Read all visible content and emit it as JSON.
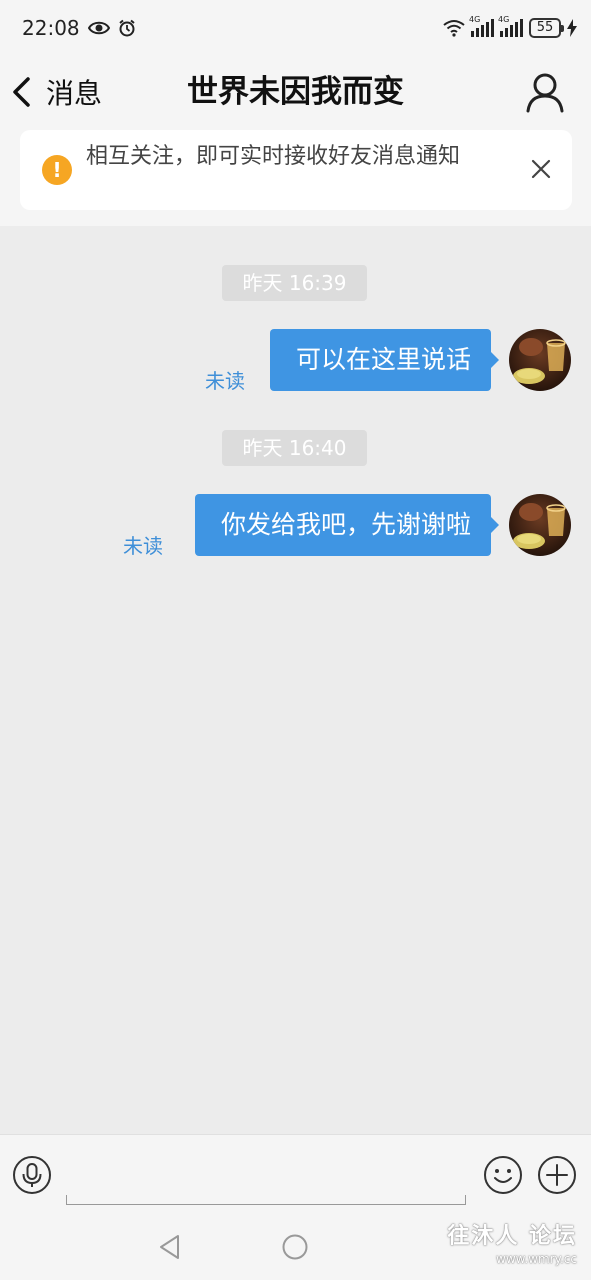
{
  "status_bar": {
    "time": "22:08",
    "signal_label_1": "4G",
    "signal_label_2": "4G",
    "battery": "55"
  },
  "header": {
    "back_label": "消息",
    "title": "世界未因我而变"
  },
  "notice": {
    "text": "相互关注，即可实时接收好友消息通知",
    "icon": "!"
  },
  "messages": [
    {
      "timestamp": "昨天 16:39",
      "text": "可以在这里说话",
      "status": "未读"
    },
    {
      "timestamp": "昨天 16:40",
      "text": "你发给我吧，先谢谢啦",
      "status": "未读"
    }
  ],
  "input": {
    "placeholder": "",
    "value": ""
  },
  "watermark": {
    "main": "往沐人 论坛",
    "sub": "www.wmry.cc"
  },
  "colors": {
    "bubble": "#3f95e3",
    "unread_text": "#3f8fd8",
    "notice_icon": "#f6a623",
    "chat_background": "#ececec"
  },
  "icons": [
    "eye-icon",
    "alarm-icon",
    "wifi-icon",
    "signal-icon",
    "battery-icon",
    "charging-icon",
    "back-chevron-icon",
    "profile-icon",
    "warning-icon",
    "close-icon",
    "microphone-icon",
    "emoji-icon",
    "plus-icon",
    "nav-back-icon",
    "nav-home-icon"
  ]
}
